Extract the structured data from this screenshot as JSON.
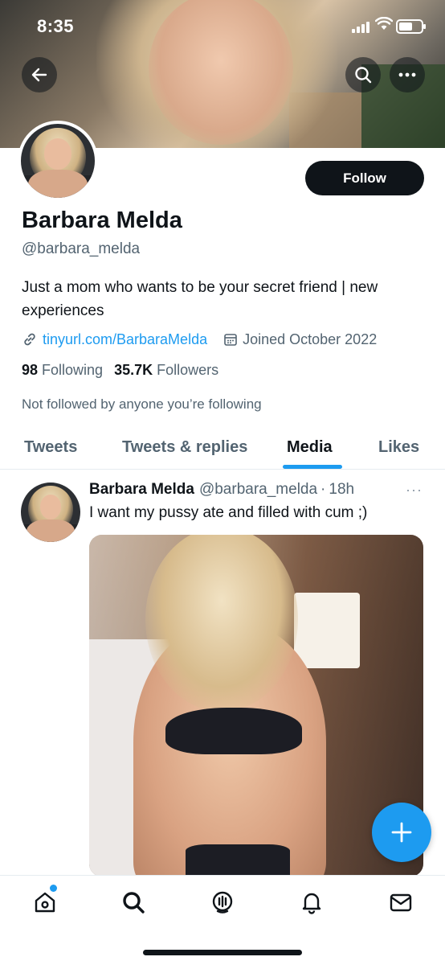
{
  "status_bar": {
    "time": "8:35"
  },
  "profile": {
    "name": "Barbara Melda",
    "handle": "@barbara_melda",
    "follow_label": "Follow",
    "bio": "Just a mom who wants to be your secret friend | new experiences",
    "link": "tinyurl.com/BarbaraMelda",
    "joined": "Joined October 2022",
    "following_count": "98",
    "following_label": "Following",
    "followers_count": "35.7K",
    "followers_label": "Followers",
    "not_followed_text": "Not followed by anyone you’re following"
  },
  "tabs": [
    {
      "label": "Tweets",
      "active": false
    },
    {
      "label": "Tweets & replies",
      "active": false
    },
    {
      "label": "Media",
      "active": true
    },
    {
      "label": "Likes",
      "active": false
    }
  ],
  "tweet": {
    "author_name": "Barbara Melda",
    "author_handle": "@barbara_melda",
    "separator": "·",
    "time": "18h",
    "more": "···",
    "text": "I want my pussy ate and filled with cum ;)"
  },
  "bottom_nav": [
    "home-icon",
    "search-icon",
    "spaces-icon",
    "notifications-icon",
    "messages-icon"
  ],
  "colors": {
    "accent": "#1d9bf0",
    "text_primary": "#0f1419",
    "text_secondary": "#536471",
    "button_dark": "#0f1419"
  }
}
